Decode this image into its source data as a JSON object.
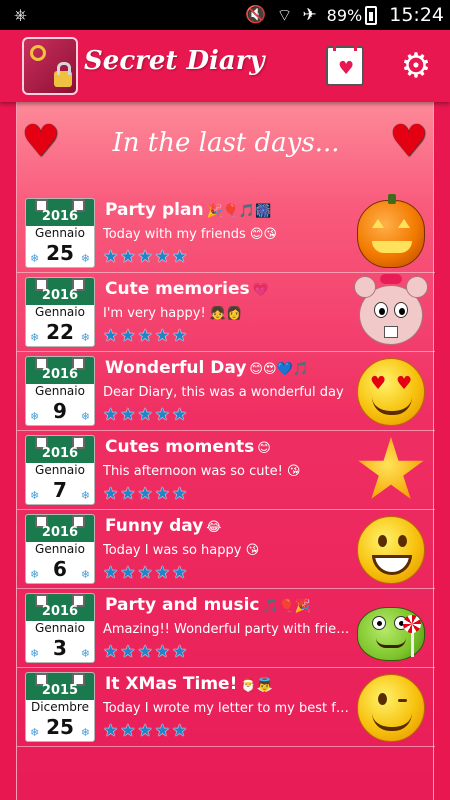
{
  "status_bar": {
    "usb_icon": "usb-icon",
    "battery": "89%",
    "time": "15:24",
    "icons": [
      "mute-icon",
      "wifi-icon",
      "airplane-icon",
      "battery-icon"
    ]
  },
  "app_bar": {
    "title": "Secret Diary",
    "icons": [
      "diary-lock-logo-icon",
      "calendar-heart-icon",
      "gear-icon"
    ]
  },
  "heading": "In the last days...",
  "colors": {
    "primary": "#e8174f",
    "calendar_green": "#1a7a4e",
    "star_blue": "#1f86c9",
    "heart_red": "#e20012"
  },
  "entries": [
    {
      "year": "2016",
      "month": "Gennaio",
      "day": "25",
      "title": "Party plan",
      "title_deco": "🎉🎈🎵🎆",
      "preview": "Today with my friends 😊😘",
      "rating": 5,
      "mood_icon": "pumpkin-icon"
    },
    {
      "year": "2016",
      "month": "Gennaio",
      "day": "22",
      "title": "Cute memories",
      "title_deco": "💗",
      "preview": "I'm very happy! 👧👩",
      "rating": 5,
      "mood_icon": "mouse-face-icon"
    },
    {
      "year": "2016",
      "month": "Gennaio",
      "day": "9",
      "title": "Wonderful Day",
      "title_deco": "😊😍💙🎵",
      "preview": "Dear Diary, this was a wonderful day",
      "rating": 5,
      "mood_icon": "heart-eyes-smiley-icon"
    },
    {
      "year": "2016",
      "month": "Gennaio",
      "day": "7",
      "title": "Cutes moments",
      "title_deco": "😊",
      "preview": "This afternoon was so cute! 😘",
      "rating": 5,
      "mood_icon": "star-icon"
    },
    {
      "year": "2016",
      "month": "Gennaio",
      "day": "6",
      "title": "Funny day",
      "title_deco": "😂",
      "preview": "Today I was so happy 😘",
      "rating": 5,
      "mood_icon": "grinning-smiley-icon"
    },
    {
      "year": "2016",
      "month": "Gennaio",
      "day": "3",
      "title": "Party and music",
      "title_deco": "🎵🎈🎉",
      "preview": "Amazing!! Wonderful party with friends",
      "rating": 5,
      "mood_icon": "frog-lollipop-icon"
    },
    {
      "year": "2015",
      "month": "Dicembre",
      "day": "25",
      "title": "It XMas Time!",
      "title_deco": "🎅👼",
      "preview": "Today I wrote my letter to my best friend",
      "rating": 5,
      "mood_icon": "winking-smiley-icon"
    }
  ]
}
